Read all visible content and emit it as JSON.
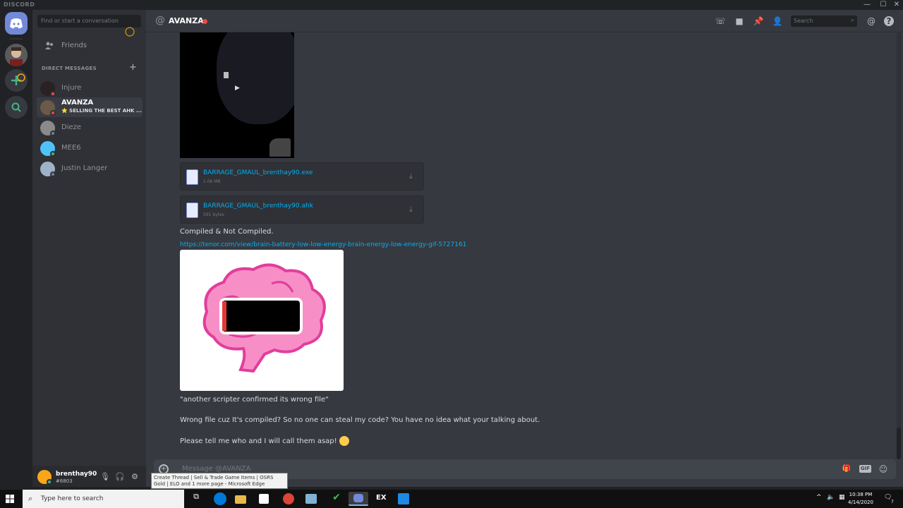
{
  "window": {
    "brand": "DISCORD",
    "minimize": "—",
    "maximize": "☐",
    "close": "✕"
  },
  "sidebar": {
    "search_placeholder": "Find or start a conversation",
    "friends_label": "Friends",
    "dm_header": "DIRECT MESSAGES",
    "dm_add": "+",
    "dms": [
      {
        "name": "Injure",
        "subtitle": "",
        "status": "dnd",
        "avatar_color": "#2a2222",
        "active": false
      },
      {
        "name": "AVANZA",
        "subtitle": "⭐ SELLING THE BEST AHK ...",
        "status": "dnd",
        "avatar_color": "#6b5a48",
        "active": true
      },
      {
        "name": "Dieze",
        "subtitle": "",
        "status": "offline",
        "avatar_color": "#8a8a8a",
        "active": false
      },
      {
        "name": "MEE6",
        "subtitle": "",
        "status": "online",
        "avatar_color": "#4fc3f7",
        "active": false
      },
      {
        "name": "Justin Langer",
        "subtitle": "",
        "status": "offline",
        "avatar_color": "#9fb3c8",
        "active": false
      }
    ]
  },
  "user": {
    "name": "brenthay90",
    "tag": "#6803"
  },
  "channel": {
    "at": "@",
    "name": "AVANZA",
    "search_placeholder": "Search"
  },
  "messages": {
    "attachments": [
      {
        "filename": "BARRAGE_GMAUL_brenthay90.exe",
        "size": "1.06 MB"
      },
      {
        "filename": "BARRAGE_GMAUL_brenthay90.ahk",
        "size": "591 bytes"
      }
    ],
    "line1": "Compiled & Not Compiled.",
    "link": "https://tenor.com/view/brain-battery-low-low-energy-brain-energy-low-energy-gif-5727161",
    "line2": "\"another scripter confirmed its wrong file\"",
    "line3": "Wrong file cuz It's compiled? So no one can steal my code? You have no idea what your talking about.",
    "line4": "Please tell me who and I will call them asap!"
  },
  "composer": {
    "placeholder": "Message @AVANZA",
    "gif_label": "GIF"
  },
  "tooltip": "Create Thread | Sell & Trade Game Items | OSRS Gold | ELO and 1 more page - Microsoft Edge",
  "taskbar": {
    "search_placeholder": "Type here to search",
    "ex_label": "EX",
    "time": "10:38 PM",
    "date": "4/14/2020",
    "notif_count": "7"
  },
  "colors": {
    "blurple": "#7289da",
    "link": "#00b0f4",
    "dnd": "#f04747",
    "online": "#43b581",
    "offline": "#747f8d"
  }
}
